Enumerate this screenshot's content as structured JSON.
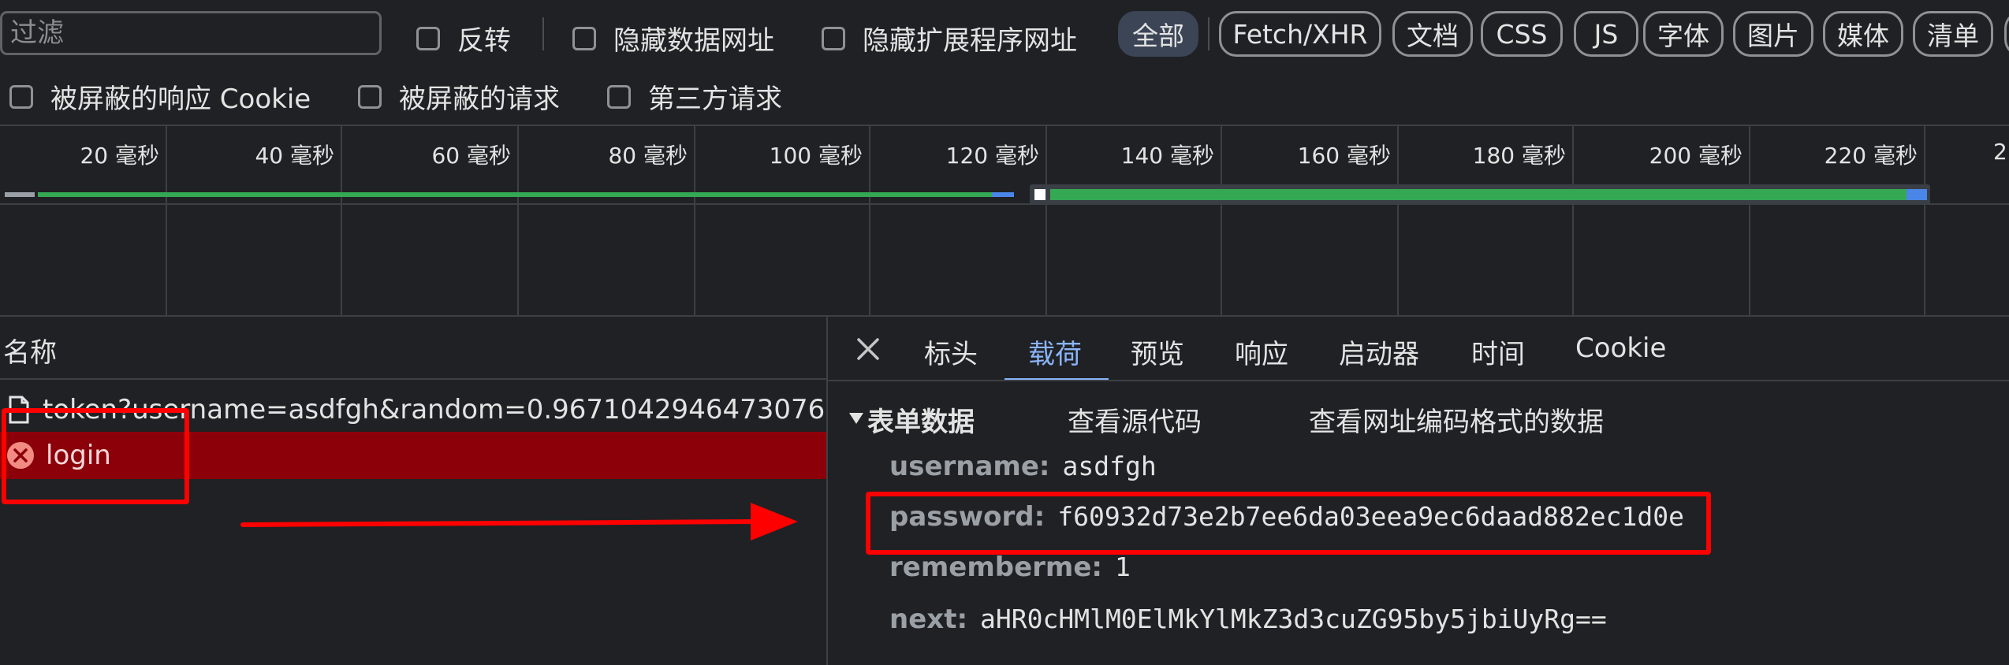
{
  "filter": {
    "placeholder": "过滤",
    "invert_label": "反转",
    "hide_data_urls_label": "隐藏数据网址",
    "hide_extension_urls_label": "隐藏扩展程序网址",
    "type_pills": [
      "全部",
      "Fetch/XHR",
      "文档",
      "CSS",
      "JS",
      "字体",
      "图片",
      "媒体",
      "清单"
    ],
    "active_pill": "全部",
    "blocked_cookies_label": "被屏蔽的响应 Cookie",
    "blocked_requests_label": "被屏蔽的请求",
    "third_party_label": "第三方请求"
  },
  "timeline": {
    "ticks": [
      "20 毫秒",
      "40 毫秒",
      "60 毫秒",
      "80 毫秒",
      "100 毫秒",
      "120 毫秒",
      "140 毫秒",
      "160 毫秒",
      "180 毫秒",
      "200 毫秒",
      "220 毫秒",
      "2"
    ]
  },
  "request_list": {
    "header": "名称",
    "rows": [
      {
        "name": "token?username=asdfgh&random=0.9671042946473076",
        "status": "ok"
      },
      {
        "name": "login",
        "status": "error"
      }
    ]
  },
  "details": {
    "tabs": [
      "标头",
      "载荷",
      "预览",
      "响应",
      "启动器",
      "时间",
      "Cookie"
    ],
    "active_tab": "载荷",
    "section_title": "表单数据",
    "view_source_label": "查看源代码",
    "view_url_encoded_label": "查看网址编码格式的数据",
    "form_data": [
      {
        "key": "username:",
        "value": "asdfgh"
      },
      {
        "key": "password:",
        "value": "f60932d73e2b7ee6da03eea9ec6daad882ec1d0e"
      },
      {
        "key": "rememberme:",
        "value": "1"
      },
      {
        "key": "next:",
        "value": "aHR0cHMlM0ElMkYlMkZ3d3cuZG95by5jbiUyRg=="
      }
    ]
  },
  "colors": {
    "background": "#202124",
    "selected_error_row": "#8b0009",
    "active_tab": "#8ab4f8",
    "annotation_red": "#ff0000",
    "timeline_green": "#34a853",
    "timeline_blue": "#4a86e8"
  }
}
